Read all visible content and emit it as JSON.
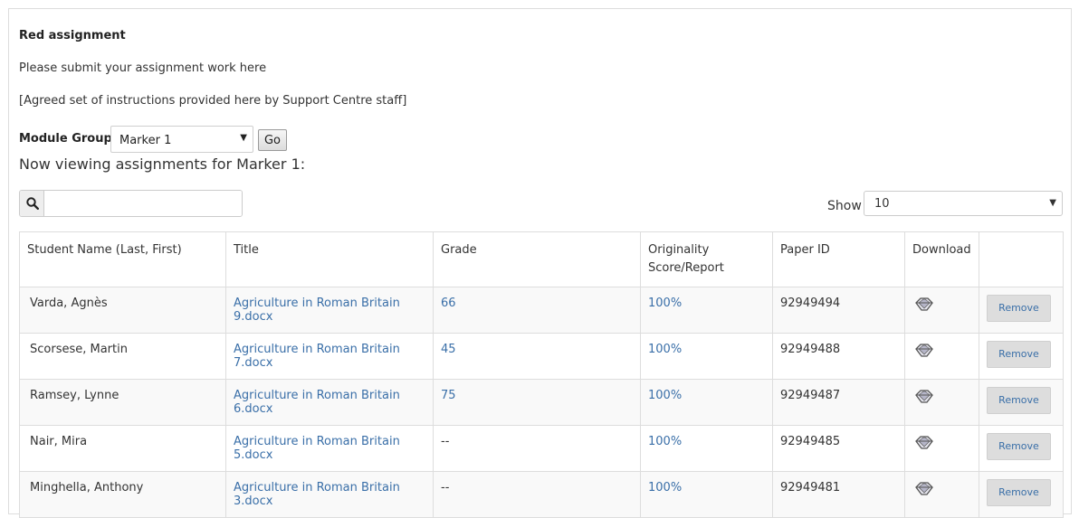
{
  "assignment": {
    "title": "Red assignment",
    "description": "Please submit your assignment work here",
    "instructions": "[Agreed set of instructions provided here by Support Centre staff]"
  },
  "module_group": {
    "label": "Module Group :",
    "selected": "Marker 1",
    "go_label": "Go"
  },
  "viewing_text": "Now viewing assignments for Marker 1:",
  "search": {
    "placeholder": "",
    "value": "",
    "icon": "search-icon"
  },
  "show": {
    "label": "Show",
    "selected": "10"
  },
  "table": {
    "headers": [
      "Student Name (Last, First)",
      "Title",
      "Grade",
      "Originality Score/Report",
      "Paper ID",
      "Download",
      ""
    ],
    "rows": [
      {
        "name": "Varda, Agnès",
        "title": "Agriculture in Roman Britain 9.docx",
        "grade": "66",
        "originality": "100%",
        "paper_id": "92949494",
        "action": "Remove"
      },
      {
        "name": "Scorsese, Martin",
        "title": "Agriculture in Roman Britain 7.docx",
        "grade": "45",
        "originality": "100%",
        "paper_id": "92949488",
        "action": "Remove"
      },
      {
        "name": "Ramsey, Lynne",
        "title": "Agriculture in Roman Britain 6.docx",
        "grade": "75",
        "originality": "100%",
        "paper_id": "92949487",
        "action": "Remove"
      },
      {
        "name": "Nair, Mira",
        "title": "Agriculture in Roman Britain 5.docx",
        "grade": "--",
        "originality": "100%",
        "paper_id": "92949485",
        "action": "Remove"
      },
      {
        "name": "Minghella, Anthony",
        "title": "Agriculture in Roman Britain 3.docx",
        "grade": "--",
        "originality": "100%",
        "paper_id": "92949481",
        "action": "Remove"
      }
    ]
  },
  "colors": {
    "link": "#3a6fa8",
    "border": "#dddddd",
    "stripe": "#f9f9f9"
  }
}
